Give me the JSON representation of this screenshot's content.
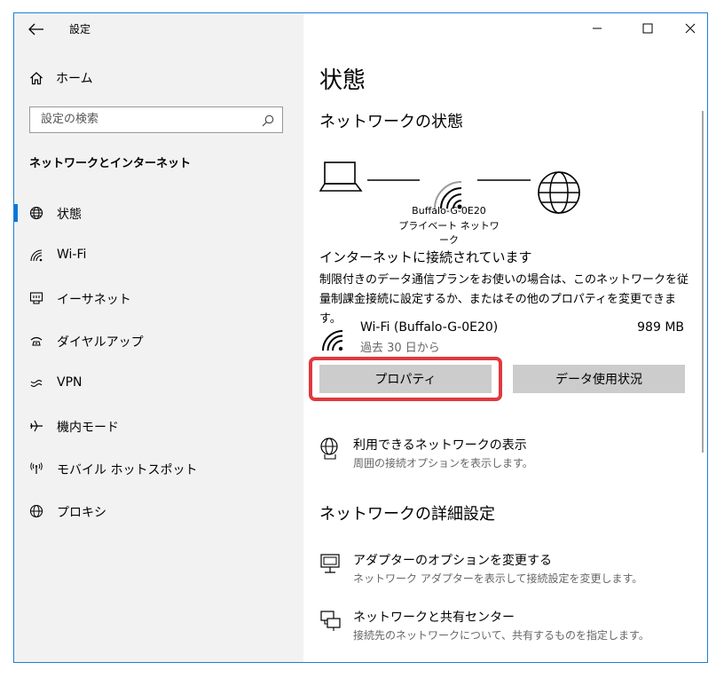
{
  "titlebar": {
    "title": "設定",
    "back_icon": "back-arrow-icon"
  },
  "sidebar": {
    "home_label": "ホーム",
    "search_placeholder": "設定の検索",
    "section_title": "ネットワークとインターネット",
    "items": [
      {
        "label": "状態",
        "icon": "status-globe-icon",
        "active": true
      },
      {
        "label": "Wi-Fi",
        "icon": "wifi-icon"
      },
      {
        "label": "イーサネット",
        "icon": "ethernet-icon"
      },
      {
        "label": "ダイヤルアップ",
        "icon": "dialup-icon"
      },
      {
        "label": "VPN",
        "icon": "vpn-icon"
      },
      {
        "label": "機内モード",
        "icon": "airplane-icon"
      },
      {
        "label": "モバイル ホットスポット",
        "icon": "hotspot-icon"
      },
      {
        "label": "プロキシ",
        "icon": "proxy-globe-icon"
      }
    ]
  },
  "main": {
    "page_title": "状態",
    "network_status_heading": "ネットワークの状態",
    "diagram": {
      "ap_name": "Buffalo-G-0E20",
      "network_type": "プライベート ネットワーク"
    },
    "connected_text": "インターネットに接続されています",
    "description": "制限付きのデータ通信プランをお使いの場合は、このネットワークを従量制課金接続に設定するか、またはその他のプロパティを変更できます。",
    "adapter": {
      "name": "Wi-Fi (Buffalo-G-0E20)",
      "data_used": "989 MB",
      "since": "過去 30 日から"
    },
    "buttons": {
      "properties": "プロパティ",
      "data_usage": "データ使用状況"
    },
    "show_networks": {
      "title": "利用できるネットワークの表示",
      "subtitle": "周囲の接続オプションを表示します。"
    },
    "advanced_heading": "ネットワークの詳細設定",
    "adapter_options": {
      "title": "アダプターのオプションを変更する",
      "subtitle": "ネットワーク アダプターを表示して接続設定を変更します。"
    },
    "sharing_center": {
      "title": "ネットワークと共有センター",
      "subtitle": "接続先のネットワークについて、共有するものを指定します。"
    }
  },
  "colors": {
    "accent": "#0078d7",
    "highlight": "#e0393e",
    "button": "#cccccc",
    "sidebar_bg": "#f2f2f2"
  }
}
